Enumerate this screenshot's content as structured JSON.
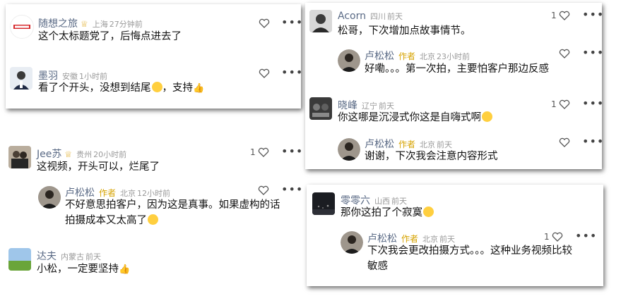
{
  "like_icon": "heart-outline-icon",
  "more_icon": "more-dots-icon",
  "more_glyph": "•••",
  "cards": [
    {
      "comments": [
        {
          "name": "随想之旅",
          "badge": "crown-badge",
          "badge_glyph": "♕",
          "location": "上海",
          "time": "27分钟前",
          "text": "这个太标题党了，后悔点进去了",
          "likes": ""
        },
        {
          "name": "墨羽",
          "location": "安徽",
          "time": "1小时前",
          "text": "看了个开头，没想到结尾",
          "suffix": "，支持",
          "likes": ""
        }
      ]
    },
    {
      "comments": [
        {
          "name": "Jee苏",
          "badge": "crown-badge",
          "badge_glyph": "♕",
          "location": "贵州",
          "time": "20小时前",
          "text": "这视频，开头可以，烂尾了",
          "likes": "1"
        },
        {
          "name": "卢松松",
          "author_tag": "作者",
          "location": "北京",
          "time": "12小时前",
          "text_lines": [
            "不好意思拍客户，因为这是真事。如果虚构的话",
            "拍摄成本又太高了"
          ],
          "likes": ""
        },
        {
          "name": "达夫",
          "location": "内蒙古",
          "time": "前天",
          "text": "小松，一定要坚持",
          "likes": ""
        }
      ]
    },
    {
      "comments": [
        {
          "name": "Acorn",
          "location": "四川",
          "time": "前天",
          "text": "松哥，下次增加点故事情节。",
          "likes": "1"
        },
        {
          "name": "卢松松",
          "author_tag": "作者",
          "location": "北京",
          "time": "23小时前",
          "text": "好嘞。。。第一次拍，主要怕客户那边反感",
          "likes": ""
        },
        {
          "name": "晓峰",
          "location": "辽宁",
          "time": "前天",
          "text": "你这哪是沉浸式你这是自嗨式啊",
          "likes": "1"
        },
        {
          "name": "卢松松",
          "author_tag": "作者",
          "location": "北京",
          "time": "前天",
          "text": "谢谢，下次我会注意内容形式",
          "likes": ""
        }
      ]
    },
    {
      "comments": [
        {
          "name": "零零六",
          "location": "山西",
          "time": "前天",
          "text": "那你这拍了个寂寞",
          "likes": ""
        },
        {
          "name": "卢松松",
          "author_tag": "作者",
          "location": "北京",
          "time": "前天",
          "text_lines": [
            "下次我会更改拍摄方式。。。这种业务视频比较",
            "敏感"
          ],
          "likes": "1"
        }
      ]
    }
  ]
}
